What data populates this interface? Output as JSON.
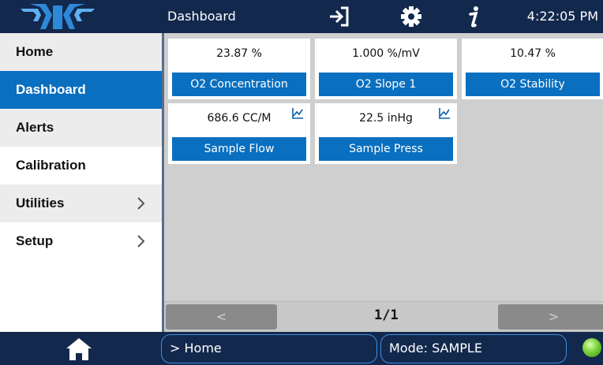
{
  "header": {
    "title": "Dashboard",
    "time": "4:22:05 PM",
    "icons": [
      "logo-icon",
      "logout-icon",
      "gear-icon",
      "info-icon"
    ]
  },
  "sidebar": {
    "items": [
      {
        "label": "Home",
        "active": false,
        "has_submenu": false
      },
      {
        "label": "Dashboard",
        "active": true,
        "has_submenu": false
      },
      {
        "label": "Alerts",
        "active": false,
        "has_submenu": false
      },
      {
        "label": "Calibration",
        "active": false,
        "has_submenu": false
      },
      {
        "label": "Utilities",
        "active": false,
        "has_submenu": true
      },
      {
        "label": "Setup",
        "active": false,
        "has_submenu": true
      }
    ]
  },
  "dashboard": {
    "tiles": [
      {
        "value": "23.87 %",
        "label": "O2 Concentration",
        "chart_icon": false
      },
      {
        "value": "1.000 %/mV",
        "label": "O2 Slope 1",
        "chart_icon": false
      },
      {
        "value": "10.47 %",
        "label": "O2 Stability",
        "chart_icon": false
      },
      {
        "value": "686.6 CC/M",
        "label": "Sample Flow",
        "chart_icon": true
      },
      {
        "value": "22.5 inHg",
        "label": "Sample Press",
        "chart_icon": true
      }
    ],
    "pager": {
      "prev": "<",
      "next": ">",
      "count": "1/1"
    }
  },
  "footer": {
    "breadcrumb": "> Home",
    "mode": "Mode: SAMPLE",
    "status_color": "#7ad23a"
  },
  "colors": {
    "header_bg": "#13284d",
    "accent": "#0a6fbf",
    "panel_bg": "#cfcfcf"
  }
}
